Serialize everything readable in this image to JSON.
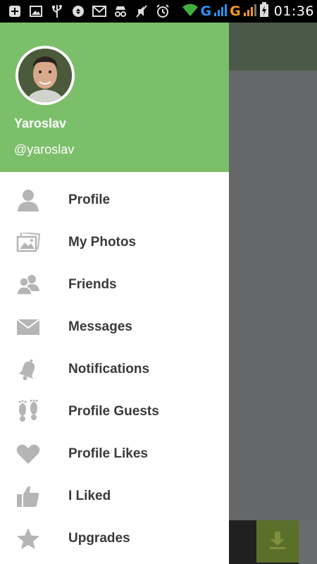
{
  "status_bar": {
    "time": "01:36",
    "network_1": "G",
    "network_2": "G",
    "network_1_color": "#2f8ff0",
    "network_2_color": "#f5962a"
  },
  "drawer": {
    "header_color": "#7cbf6a",
    "user": {
      "name": "Yaroslav",
      "handle": "@yaroslav"
    },
    "items": [
      {
        "label": "Profile",
        "icon": "person-icon"
      },
      {
        "label": "My Photos",
        "icon": "photos-icon"
      },
      {
        "label": "Friends",
        "icon": "friends-icon"
      },
      {
        "label": "Messages",
        "icon": "envelope-icon"
      },
      {
        "label": "Notifications",
        "icon": "bell-icon"
      },
      {
        "label": "Profile Guests",
        "icon": "footprints-icon"
      },
      {
        "label": "Profile Likes",
        "icon": "heart-icon"
      },
      {
        "label": "I Liked",
        "icon": "thumbs-up-icon"
      },
      {
        "label": "Upgrades",
        "icon": "star-icon"
      }
    ]
  },
  "background_app": {
    "download_icon": "download-icon"
  }
}
